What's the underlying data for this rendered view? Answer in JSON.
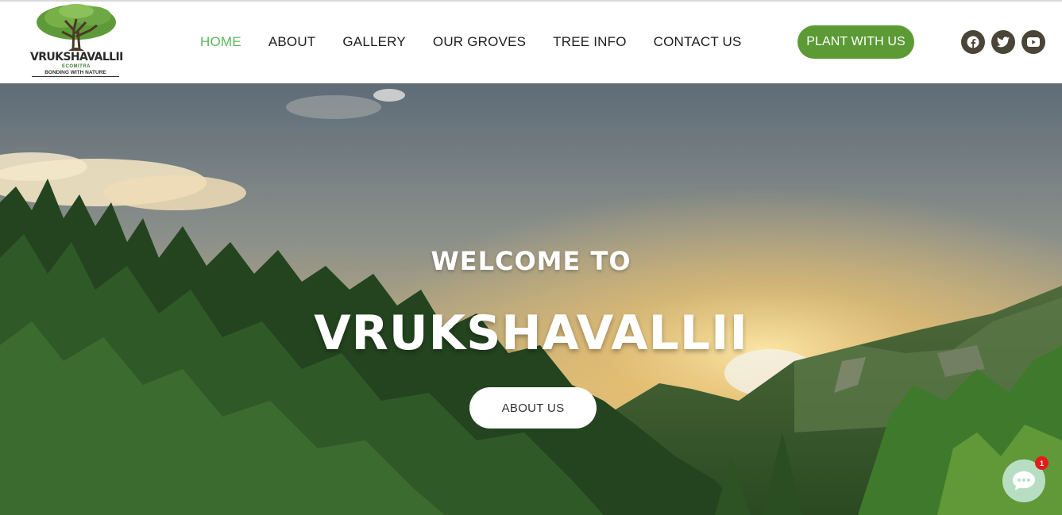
{
  "logo": {
    "title": "VRUKSHAVALLII",
    "subtitle": "ECOMITRA",
    "tagline": "BONDING WITH NATURE"
  },
  "nav": {
    "items": [
      {
        "label": "HOME",
        "active": true
      },
      {
        "label": "ABOUT"
      },
      {
        "label": "GALLERY"
      },
      {
        "label": "OUR GROVES"
      },
      {
        "label": "TREE INFO"
      },
      {
        "label": "CONTACT US"
      }
    ]
  },
  "cta": {
    "label": "PLANT WITH US"
  },
  "socials": [
    "facebook-icon",
    "twitter-icon",
    "youtube-icon"
  ],
  "hero": {
    "welcome": "WELCOME TO",
    "brand": "VRUKSHAVALLII",
    "button": "ABOUT US"
  },
  "chat": {
    "badge": "1"
  },
  "colors": {
    "accent_green": "#5cb85c",
    "cta_green": "#5b9a35",
    "social_bg": "#4a4538",
    "chat_bg": "#b7dec3",
    "badge_red": "#e51b1b"
  }
}
